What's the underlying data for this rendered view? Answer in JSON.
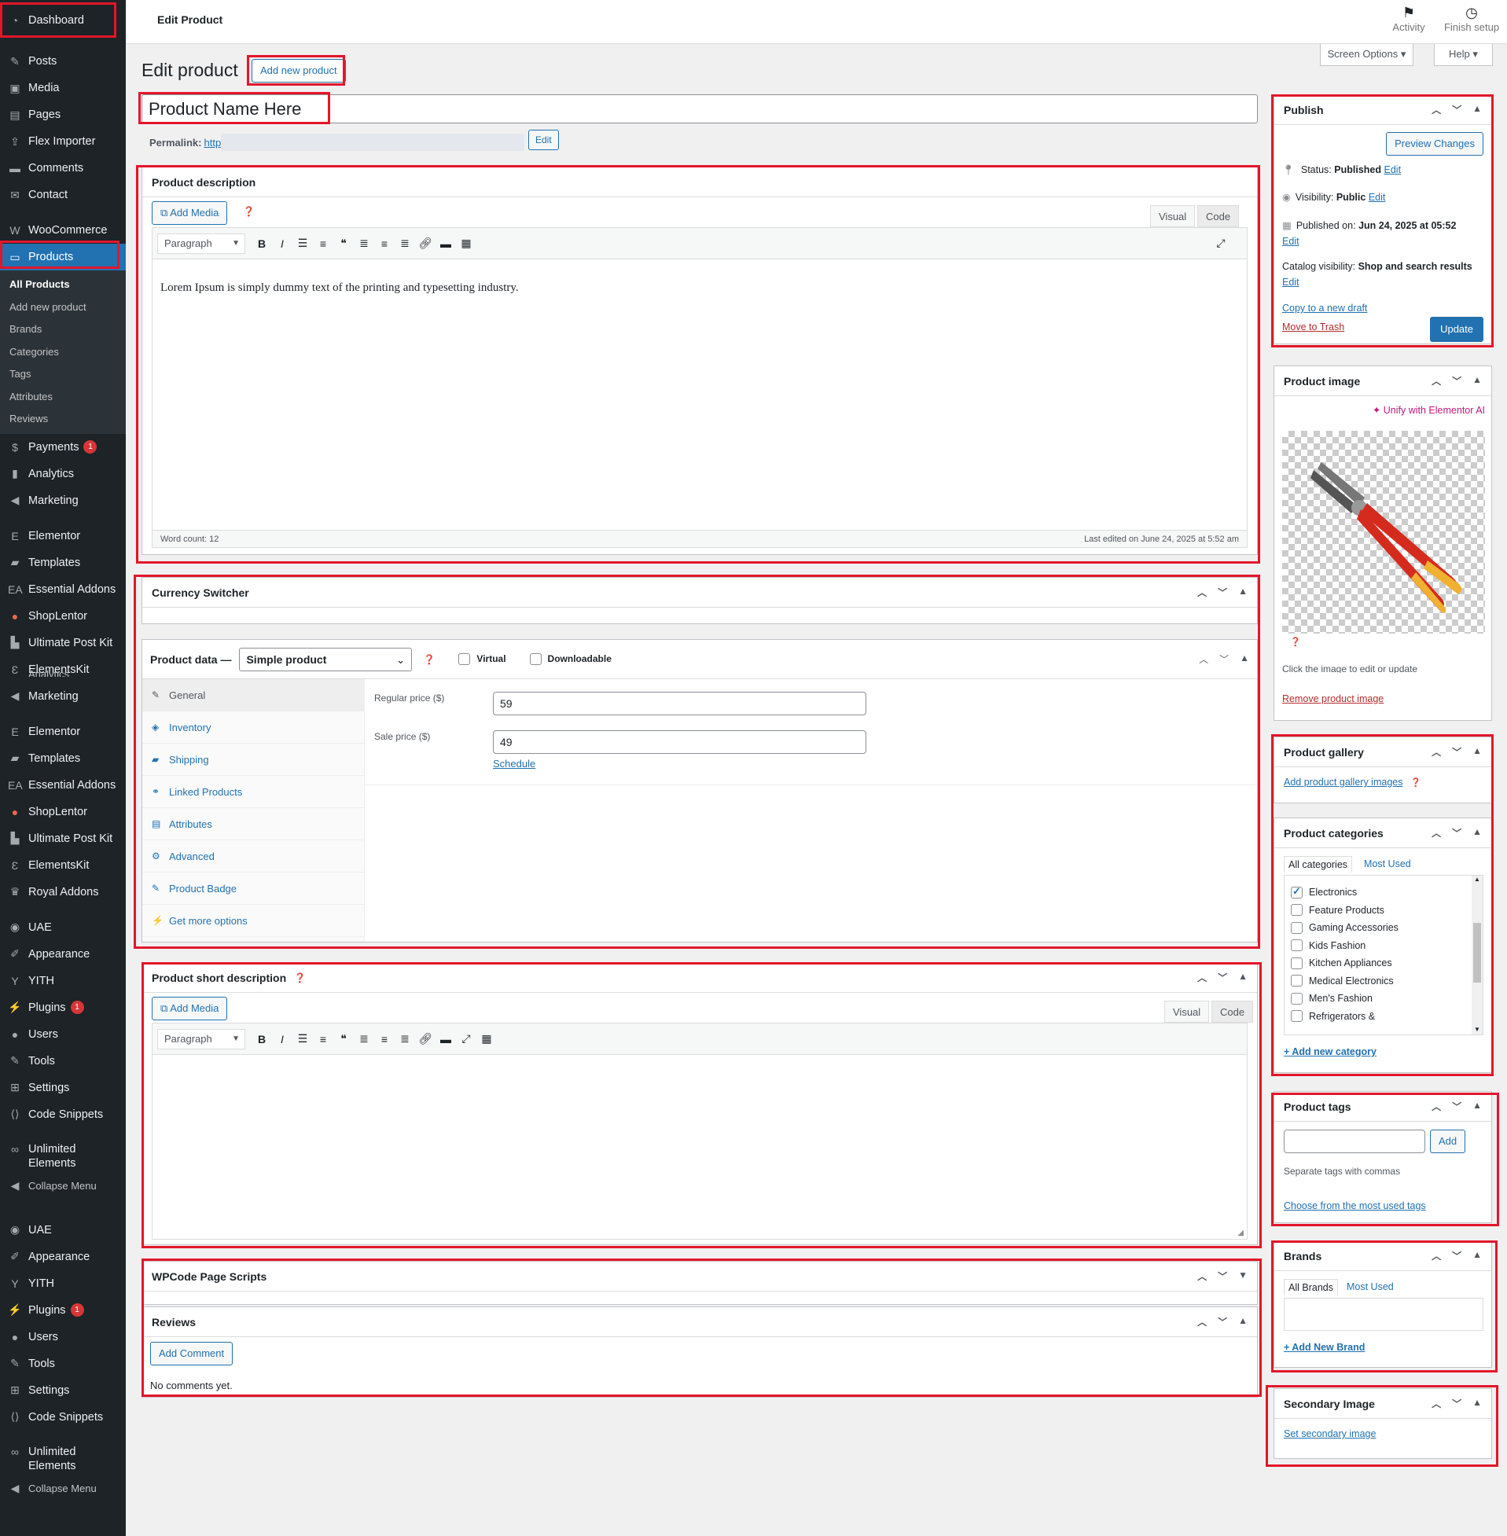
{
  "sidebar": {
    "dashboard": "Dashboard",
    "items_a": [
      "Posts",
      "Media",
      "Pages",
      "Flex Importer",
      "Comments",
      "Contact"
    ],
    "woocommerce": "WooCommerce",
    "products": "Products",
    "products_sub": [
      "All Products",
      "Add new product",
      "Brands",
      "Categories",
      "Tags",
      "Attributes",
      "Reviews"
    ],
    "payments": "Payments",
    "payments_badge": "1",
    "analytics": "Analytics",
    "marketing": "Marketing",
    "group1": [
      "Elementor",
      "Templates",
      "Essential Addons",
      "ShopLentor",
      "Ultimate Post Kit",
      "ElementsKit"
    ],
    "analytics_overlap": "Analytics",
    "marketing2": "Marketing",
    "group2": [
      "Elementor",
      "Templates",
      "Essential Addons",
      "ShopLentor",
      "Ultimate Post Kit",
      "ElementsKit",
      "Royal Addons"
    ],
    "group3": [
      "UAE",
      "Appearance",
      "YITH",
      "Plugins",
      "Users",
      "Tools",
      "Settings",
      "Code Snippets"
    ],
    "plugins_badge": "1",
    "unlimited_elements": "Unlimited Elements",
    "collapse": "Collapse Menu"
  },
  "topbar": {
    "title": "Edit Product",
    "activity": "Activity",
    "finish_setup": "Finish setup"
  },
  "screen_options": "Screen Options",
  "help": "Help",
  "heading": "Edit product",
  "add_new_product": "Add new product",
  "product_name": "Product Name Here",
  "permalink": {
    "label": "Permalink:",
    "url": "http",
    "edit": "Edit"
  },
  "description": {
    "title": "Product description",
    "add_media": "Add Media",
    "tab_visual": "Visual",
    "tab_code": "Code",
    "format": "Paragraph",
    "content": "Lorem Ipsum is simply dummy text of the printing and typesetting industry.",
    "word_count": "Word count: 12",
    "last_edited": "Last edited on June 24, 2025 at 5:52 am"
  },
  "currency_switcher": {
    "title": "Currency Switcher"
  },
  "product_data": {
    "title": "Product data —",
    "type": "Simple product",
    "virtual": "Virtual",
    "downloadable": "Downloadable",
    "tabs": [
      "General",
      "Inventory",
      "Shipping",
      "Linked Products",
      "Attributes",
      "Advanced",
      "Product Badge",
      "Get more options"
    ],
    "regular_price_label": "Regular price ($)",
    "regular_price": "59",
    "sale_price_label": "Sale price ($)",
    "sale_price": "49",
    "schedule": "Schedule"
  },
  "short_description": {
    "title": "Product short description",
    "add_media": "Add Media",
    "tab_visual": "Visual",
    "tab_code": "Code",
    "format": "Paragraph"
  },
  "wpcode": {
    "title": "WPCode Page Scripts"
  },
  "reviews": {
    "title": "Reviews",
    "add_comment": "Add Comment",
    "empty": "No comments yet."
  },
  "publish": {
    "title": "Publish",
    "preview": "Preview Changes",
    "status_label": "Status:",
    "status": "Published",
    "visibility_label": "Visibility:",
    "visibility": "Public",
    "published_on_label": "Published on:",
    "published_on": "Jun 24, 2025 at 05:52",
    "catalog_label": "Catalog visibility:",
    "catalog": "Shop and search results",
    "edit": "Edit",
    "copy_draft": "Copy to a new draft",
    "trash": "Move to Trash",
    "update": "Update"
  },
  "product_image": {
    "title": "Product image",
    "elementor_ai": "Unify with Elementor AI",
    "hint": "Click the image to edit or update",
    "remove": "Remove product image"
  },
  "gallery": {
    "title": "Product gallery",
    "add": "Add product gallery images"
  },
  "categories": {
    "title": "Product categories",
    "tab_all": "All categories",
    "tab_most": "Most Used",
    "items": [
      {
        "name": "Electronics",
        "checked": true
      },
      {
        "name": "Feature Products",
        "checked": false
      },
      {
        "name": "Gaming Accessories",
        "checked": false
      },
      {
        "name": "Kids Fashion",
        "checked": false
      },
      {
        "name": "Kitchen Appliances",
        "checked": false
      },
      {
        "name": "Medical Electronics",
        "checked": false
      },
      {
        "name": "Men's Fashion",
        "checked": false
      },
      {
        "name": "Refrigerators &",
        "checked": false
      }
    ],
    "add_new": "+ Add new category"
  },
  "tags": {
    "title": "Product tags",
    "add": "Add",
    "hint": "Separate tags with commas",
    "choose": "Choose from the most used tags"
  },
  "brands": {
    "title": "Brands",
    "tab_all": "All Brands",
    "tab_most": "Most Used",
    "add_new": "+ Add New Brand"
  },
  "secondary_image": {
    "title": "Secondary Image",
    "set": "Set secondary image"
  },
  "colors": {
    "sidebar": "#1d2327",
    "accent": "#2271b1",
    "highlight_box": "#e3162b",
    "badge": "#d63638"
  }
}
